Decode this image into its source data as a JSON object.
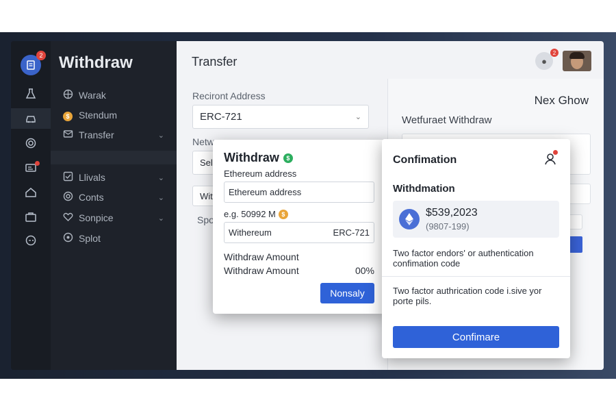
{
  "rail": {
    "logo_badge": "2",
    "icons": [
      "flask-icon",
      "car-icon",
      "camera-icon",
      "id-card-icon",
      "house-icon",
      "briefcase-icon",
      "gamepad-icon"
    ]
  },
  "sidebar": {
    "title": "Withdraw",
    "items": [
      {
        "label": "Warak",
        "icon": "globe-icon"
      },
      {
        "label": "Stendum",
        "icon": "coin-icon"
      },
      {
        "label": "Transfer",
        "icon": "mail-icon"
      },
      {
        "label": "Llivals",
        "icon": "check-square-icon"
      },
      {
        "label": "Conts",
        "icon": "target-icon"
      },
      {
        "label": "Sonpice",
        "icon": "heart-check-icon"
      },
      {
        "label": "Splot",
        "icon": "circle-dot-icon"
      }
    ]
  },
  "main": {
    "title": "Transfer",
    "header_bell_badge": "2",
    "recipient_label": "Reciront Address",
    "recipient_value": "ERC-721",
    "network_label": "Netw",
    "field2_text": "Sel",
    "field3_text": "Wit",
    "label4": "Spo"
  },
  "right_panel": {
    "title": "Nex Ghow",
    "subtitle": "Wetfuraet Withdraw"
  },
  "withdraw_card": {
    "title": "Withdraw",
    "title_badge": "$",
    "address_label": "Ethereum address",
    "address_value": "Ethereum address",
    "example_label": "e.g. 50992 M",
    "example_badge": "$",
    "token_name": "Withereum",
    "token_standard": "ERC-721",
    "amount_label_1": "Withdraw Amount",
    "amount_label_2": "Withdraw Amount",
    "amount_percent": "00%",
    "button_label": "Nonsaly"
  },
  "confirm_card": {
    "title": "Confimation",
    "subtitle": "Withdmation",
    "amount": "$539,2023",
    "amount_sub": "(9807-199)",
    "two_factor_label": "Two factor endors' or authentication confimation code",
    "two_factor_hint": "Two factor authrication code i.sive yor porte pils.",
    "button_label": "Confimare"
  },
  "colors": {
    "accent": "#2f62d8",
    "sidebar_bg": "#1e222a",
    "badge_red": "#e0443c",
    "success_green": "#2dae5f"
  }
}
